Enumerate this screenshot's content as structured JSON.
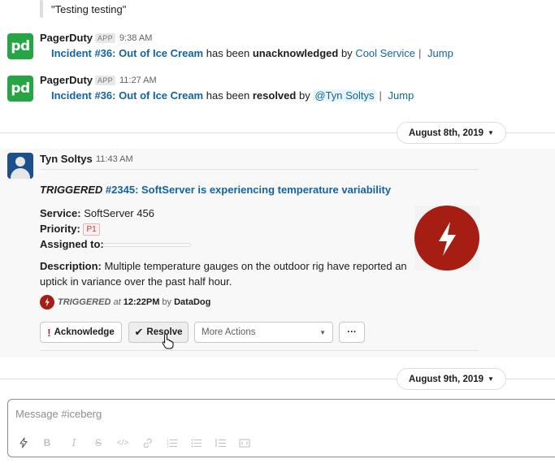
{
  "quoted": {
    "text": "\"Testing testing\""
  },
  "messages": [
    {
      "sender": "PagerDuty",
      "badge": "APP",
      "avatar_text": "pd",
      "time": "9:38 AM",
      "incident": "Incident #36: Out of Ice Cream",
      "has_been": "has been",
      "status": "unacknowledged",
      "by": "by",
      "actor": "Cool Service",
      "sep": "|",
      "jump": "Jump"
    },
    {
      "sender": "PagerDuty",
      "badge": "APP",
      "avatar_text": "pd",
      "time": "11:27 AM",
      "incident": "Incident #36: Out of Ice Cream",
      "has_been": "has been",
      "status": "resolved",
      "by": "by",
      "actor": "@Tyn Soltys",
      "sep": "|",
      "jump": "Jump"
    }
  ],
  "date_dividers": [
    "August 8th, 2019",
    "August 9th, 2019"
  ],
  "alert_message": {
    "sender": "Tyn Soltys",
    "time": "11:43 AM",
    "triggered_label": "TRIGGERED",
    "incident_link": "#2345: SoftServer is experiencing temperature variability",
    "service_label": "Service:",
    "service_value": "SoftServer 456",
    "priority_label": "Priority:",
    "priority_value": "P1",
    "assigned_label": "Assigned to:",
    "description_label": "Description:",
    "description_value": "Multiple temperature gauges on the outdoor rig have reported an uptick in variance over the past half hour.",
    "footer": {
      "status": "TRIGGERED",
      "at": "at",
      "time": "12:22PM",
      "by": "by",
      "source": "DataDog"
    },
    "actions": {
      "acknowledge": "Acknowledge",
      "resolve": "Resolve",
      "more_actions": "More Actions",
      "overflow": "···"
    },
    "accent_color": "#a51d13"
  },
  "composer": {
    "placeholder": "Message #iceberg"
  },
  "colors": {
    "link": "#1264a3",
    "pagerduty_green": "#25a544",
    "alert_red": "#a51d13"
  }
}
